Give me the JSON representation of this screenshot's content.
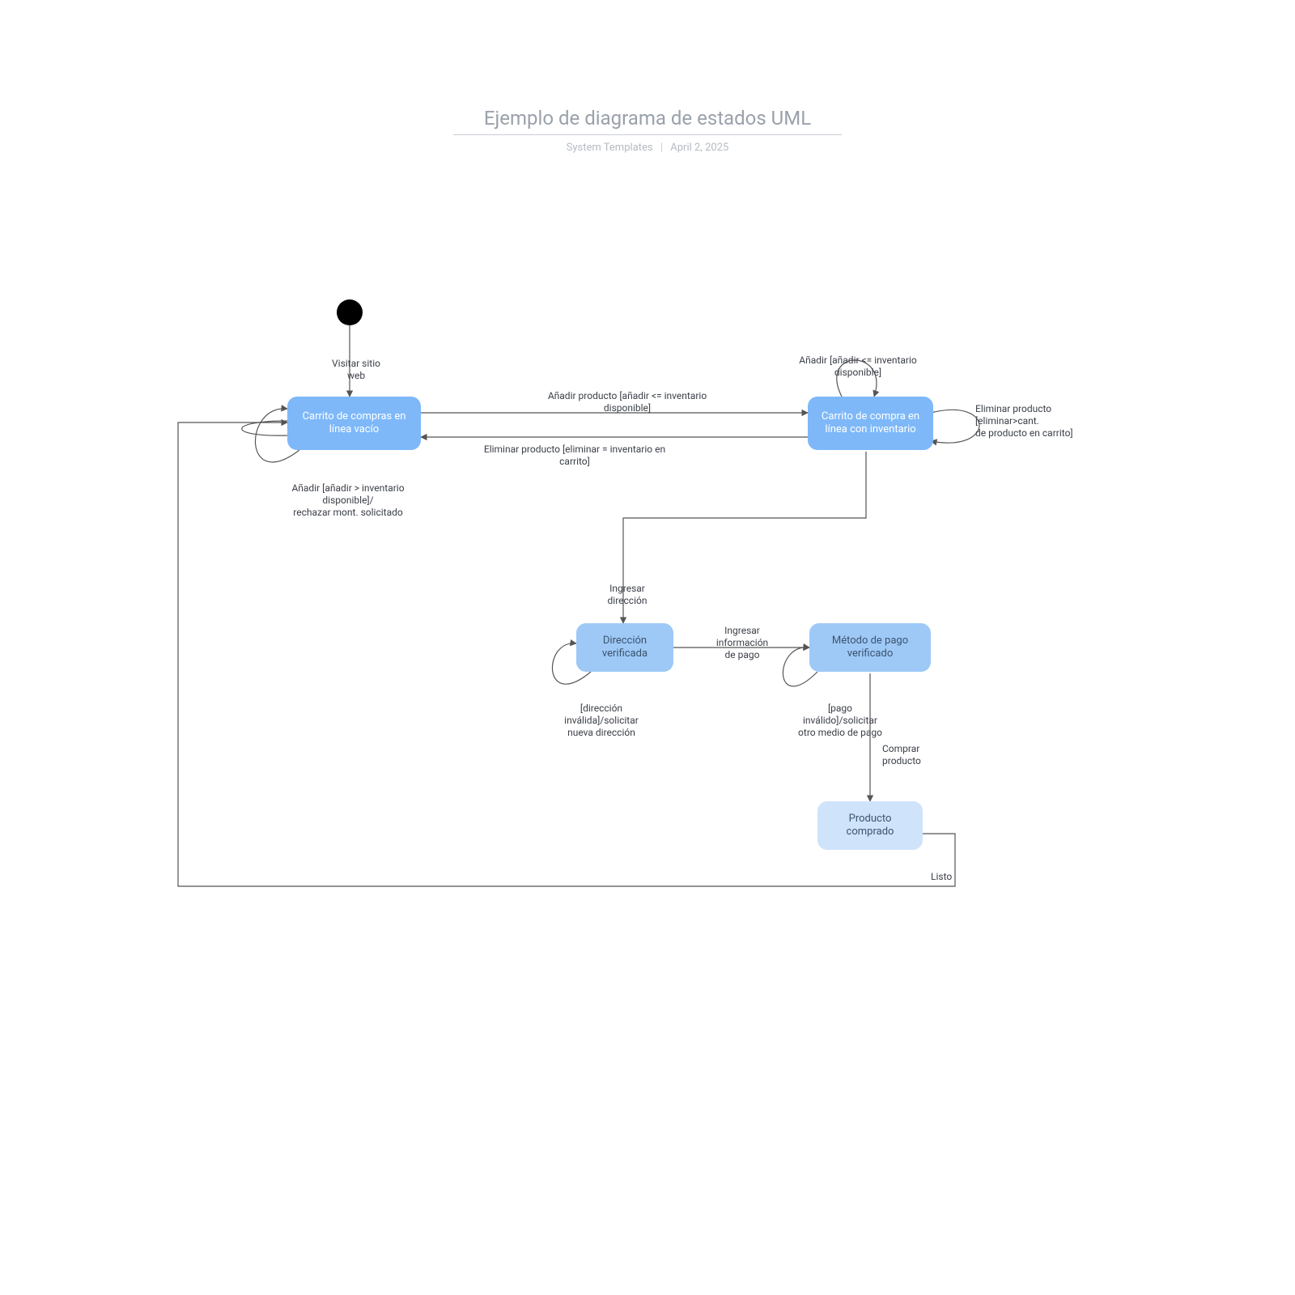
{
  "header": {
    "title": "Ejemplo de diagrama de estados UML",
    "author": "System Templates",
    "date": "April 2, 2025"
  },
  "states": {
    "empty_cart": "Carrito de\ncompras en línea\nvacío",
    "cart_inv": "Carrito de compra\nen línea con\ninventario",
    "addr_ok": "Dirección\nverificada",
    "pay_ok": "Método de pago\nverificado",
    "purchased": "Producto\ncomprado"
  },
  "transitions": {
    "visit": "Visitar sitio\nweb",
    "add_empty_to_inv": "Añadir producto [añadir <= inventario\ndisponible]",
    "del_inv_to_empty": "Eliminar producto [eliminar = inventario en\ncarrito]",
    "add_self_inv": "Añadir [añadir <= inventario\ndisponible]",
    "del_self_inv": "Eliminar producto\n[eliminar>cant.\nde producto en carrito]",
    "add_self_empty": "Añadir [añadir > inventario\ndisponible]/\nrechazar mont. solicitado",
    "enter_addr": "Ingresar\ndirección",
    "addr_invalid": "[dirección\ninválida]/solicitar\nnueva dirección",
    "enter_pay": "Ingresar\ninformación\nde pago",
    "pay_invalid": "[pago\ninválido]/solicitar\notro medio de pago",
    "buy": "Comprar\nproducto",
    "done": "Listo"
  }
}
